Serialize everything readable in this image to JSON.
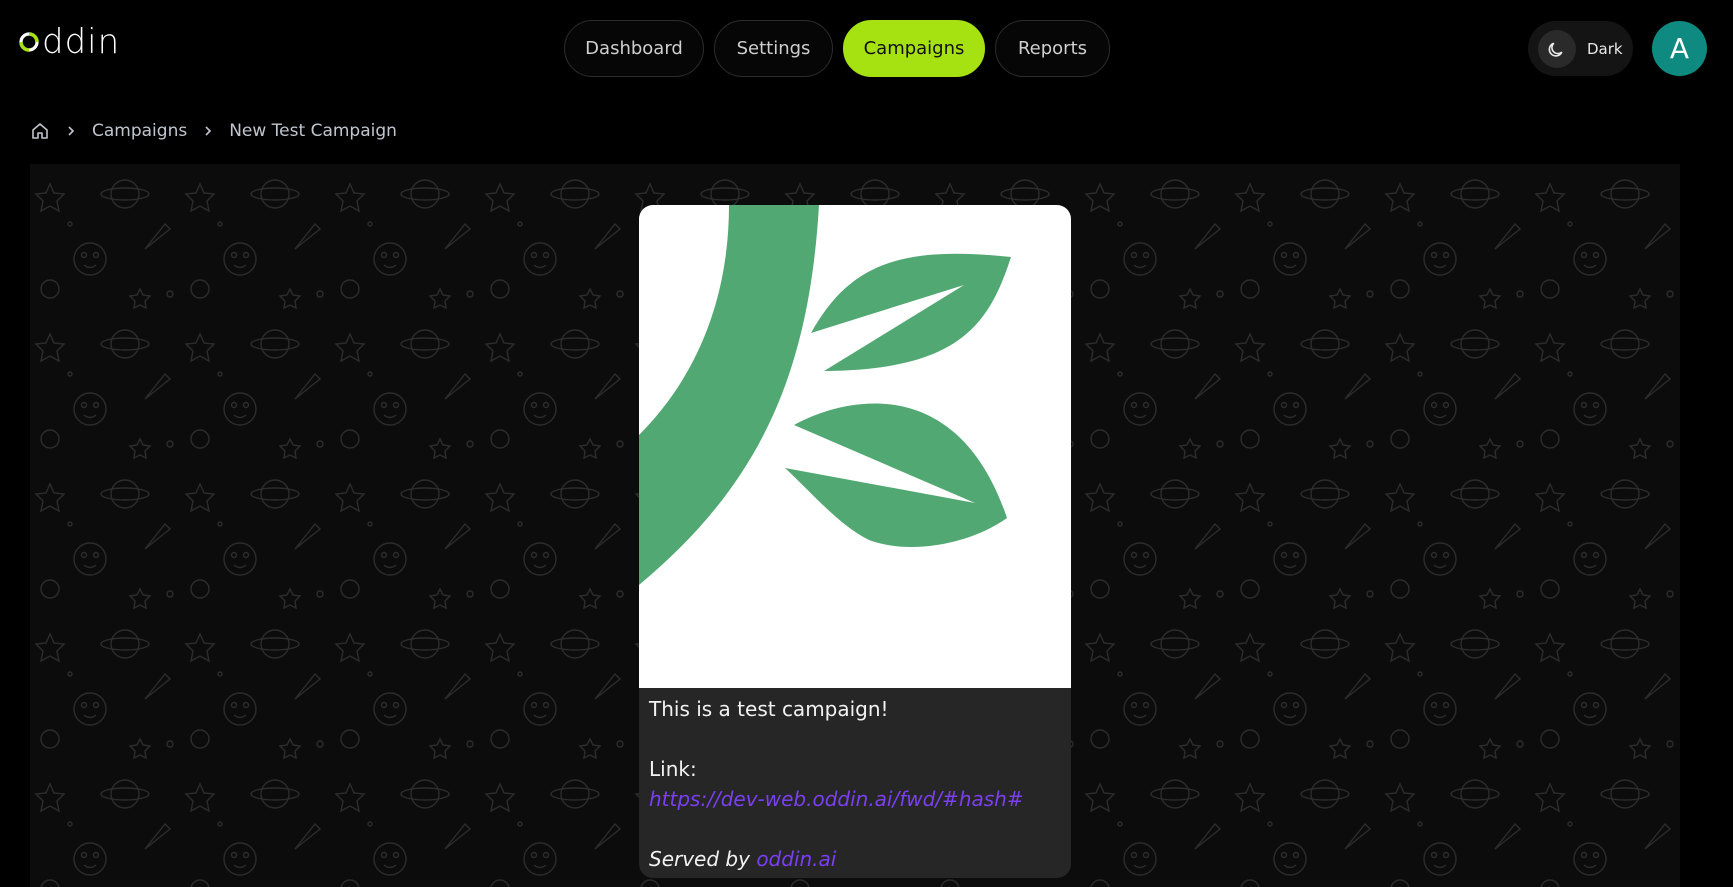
{
  "header": {
    "logo_text": "ddin",
    "nav": [
      {
        "label": "Dashboard",
        "active": false
      },
      {
        "label": "Settings",
        "active": false
      },
      {
        "label": "Campaigns",
        "active": true
      },
      {
        "label": "Reports",
        "active": false
      }
    ],
    "theme_label": "Dark",
    "avatar_initial": "A"
  },
  "breadcrumb": {
    "home_icon": "home-icon",
    "items": [
      "Campaigns",
      "New Test Campaign"
    ]
  },
  "card": {
    "message": "This is a test campaign!",
    "link_label": "Link:",
    "link_url": "https://dev-web.oddin.ai/fwd/#hash#",
    "served_prefix": "Served by",
    "served_brand": "oddin.ai"
  },
  "colors": {
    "accent": "#a6e112",
    "avatar": "#0f8a80",
    "link": "#7b3ff2",
    "leaf_green": "#52a872",
    "background": "#000000",
    "card_bg": "#262626"
  }
}
